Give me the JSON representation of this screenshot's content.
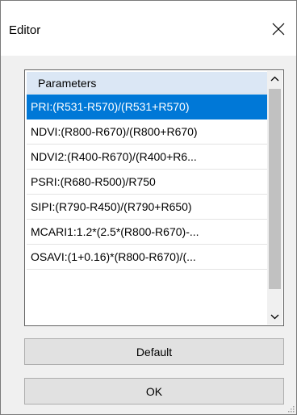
{
  "window": {
    "title": "Editor"
  },
  "parameters": {
    "header": "Parameters",
    "items": [
      "PRI:(R531-R570)/(R531+R570)",
      "NDVI:(R800-R670)/(R800+R670)",
      "NDVI2:(R400-R670)/(R400+R6...",
      "PSRI:(R680-R500)/R750",
      "SIPI:(R790-R450)/(R790+R650)",
      "MCARI1:1.2*(2.5*(R800-R670)-...",
      "OSAVI:(1+0.16)*(R800-R670)/(..."
    ],
    "selected_index": 0
  },
  "buttons": {
    "default_label": "Default",
    "ok_label": "OK"
  },
  "icons": {
    "close": "close-icon",
    "scroll_up": "chevron-up-icon",
    "scroll_down": "chevron-down-icon",
    "resize_grip": "resize-grip-icon"
  },
  "colors": {
    "selection": "#0078d7",
    "header_bg": "#dbe7f5",
    "button_bg": "#e1e1e1",
    "window_bg": "#f0f0f0"
  }
}
